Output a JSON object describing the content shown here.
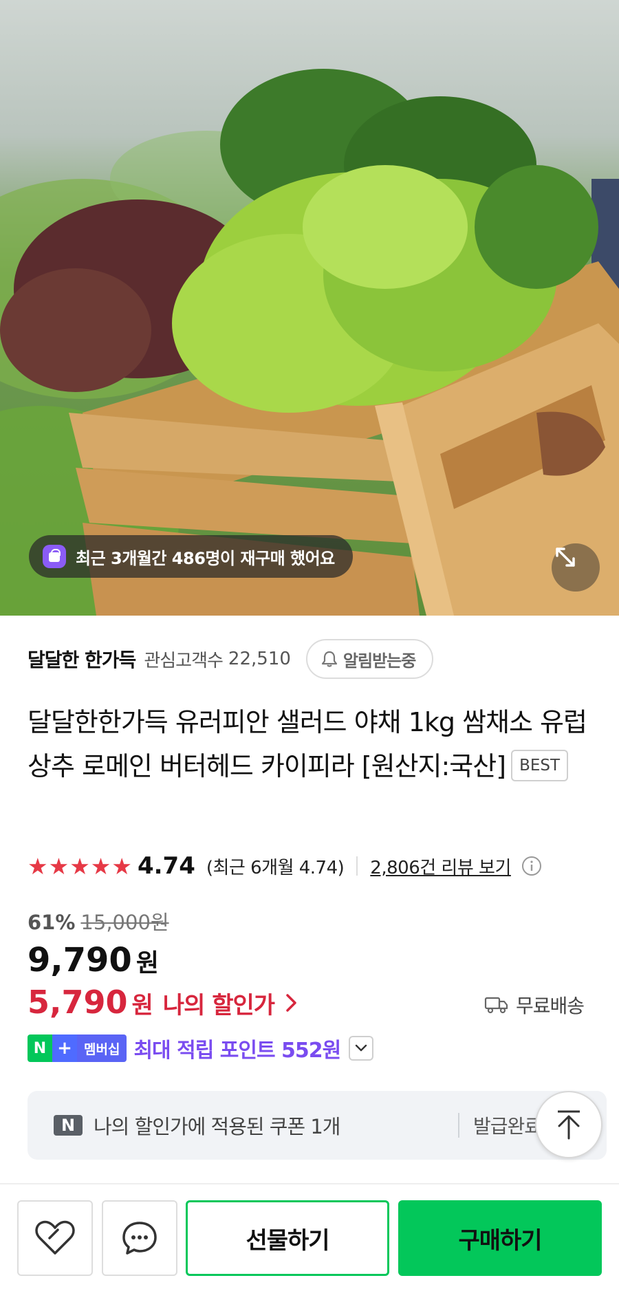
{
  "hero": {
    "image_alt": "Crate of fresh mixed salad greens",
    "repurchase_badge": "최근 3개월간 486명이 재구매 했어요",
    "expand_icon": "expand-icon"
  },
  "store": {
    "name": "달달한 한가득",
    "watchers_label": "관심고객수",
    "watchers_count": "22,510",
    "notify_label": "알림받는중"
  },
  "product": {
    "title": "달달한한가득 유러피안 샐러드 야채 1kg 쌈채소 유럽 상추 로메인 버터헤드 카이피라 [원산지:국산]",
    "badge": "BEST"
  },
  "rating": {
    "stars_shown": 5,
    "value": "4.74",
    "recent": "(최근 6개월 4.74)",
    "reviews_link": "2,806건 리뷰 보기"
  },
  "price": {
    "discount_rate": "61%",
    "original": "15,000원",
    "sale": "9,790",
    "sale_unit": "원",
    "my_price": "5,790",
    "my_price_unit": "원",
    "my_price_label": "나의 할인가",
    "shipping": "무료배송"
  },
  "membership": {
    "n": "N",
    "plus": "+",
    "label": "멤버십",
    "points_text": "최대 적립 포인트 552원"
  },
  "coupon": {
    "icon": "N",
    "text": "나의 할인가에 적용된 쿠폰 1개",
    "status": "발급완료"
  },
  "bottom_bar": {
    "gift_label": "선물하기",
    "buy_label": "구매하기"
  },
  "colors": {
    "brand_green": "#03c75a",
    "discount_red": "#d7263d",
    "points_purple": "#7a4cf0"
  }
}
